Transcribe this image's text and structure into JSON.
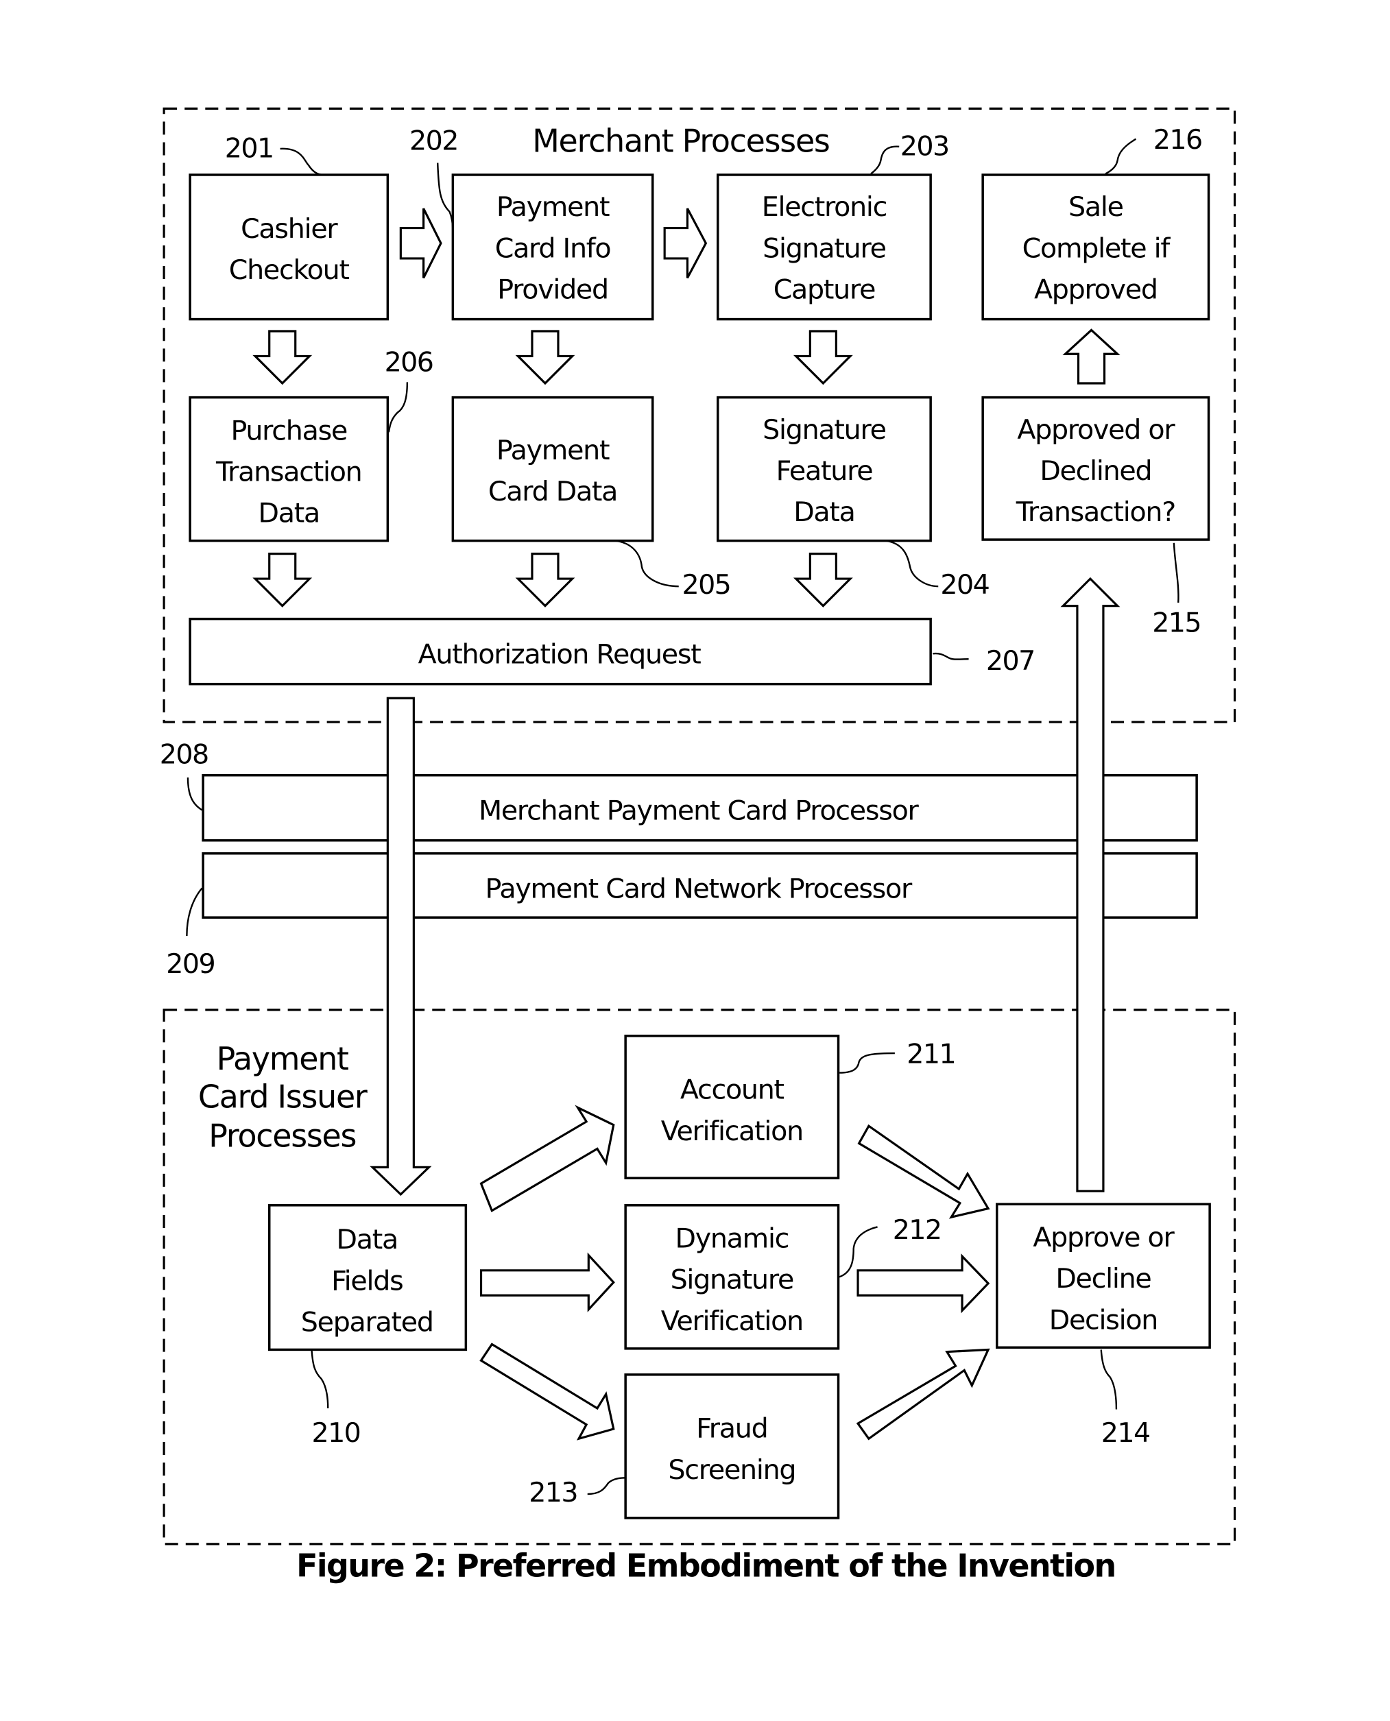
{
  "figure": {
    "caption": "Figure 2: Preferred Embodiment of the Invention",
    "sections": {
      "merchant": "Merchant Processes",
      "issuer": [
        "Payment",
        "Card Issuer",
        "Processes"
      ]
    },
    "boxes": {
      "b201": {
        "ref": "201",
        "lines": [
          "Cashier",
          "Checkout"
        ]
      },
      "b202": {
        "ref": "202",
        "lines": [
          "Payment",
          "Card Info",
          "Provided"
        ]
      },
      "b203": {
        "ref": "203",
        "lines": [
          "Electronic",
          "Signature",
          "Capture"
        ]
      },
      "b216": {
        "ref": "216",
        "lines": [
          "Sale",
          "Complete if",
          "Approved"
        ]
      },
      "b206": {
        "ref": "206",
        "lines": [
          "Purchase",
          "Transaction",
          "Data"
        ]
      },
      "b205": {
        "ref": "205",
        "lines": [
          "Payment",
          "Card Data"
        ]
      },
      "b204": {
        "ref": "204",
        "lines": [
          "Signature",
          "Feature",
          "Data"
        ]
      },
      "b215": {
        "ref": "215",
        "lines": [
          "Approved or",
          "Declined",
          "Transaction?"
        ]
      },
      "b207": {
        "ref": "207",
        "lines": [
          "Authorization Request"
        ]
      },
      "b208": {
        "ref": "208",
        "lines": [
          "Merchant Payment Card Processor"
        ]
      },
      "b209": {
        "ref": "209",
        "lines": [
          "Payment Card Network Processor"
        ]
      },
      "b210": {
        "ref": "210",
        "lines": [
          "Data",
          "Fields",
          "Separated"
        ]
      },
      "b211": {
        "ref": "211",
        "lines": [
          "Account",
          "Verification"
        ]
      },
      "b212": {
        "ref": "212",
        "lines": [
          "Dynamic",
          "Signature",
          "Verification"
        ]
      },
      "b213": {
        "ref": "213",
        "lines": [
          "Fraud",
          "Screening"
        ]
      },
      "b214": {
        "ref": "214",
        "lines": [
          "Approve or",
          "Decline",
          "Decision"
        ]
      }
    }
  }
}
